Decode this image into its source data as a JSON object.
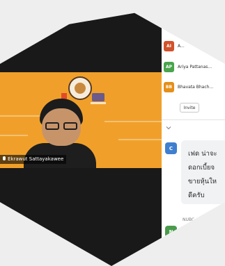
{
  "video": {
    "participant_name": "Ekrawut Sattayakawee"
  },
  "participants": [
    {
      "initials": "AI",
      "name": "A...",
      "color": "#d2522b"
    },
    {
      "initials": "AP",
      "name": "Ariya Pattanas...",
      "color": "#49a44c"
    },
    {
      "initials": "BB",
      "name": "Bhavata Bhach...",
      "color": "#e58f19"
    }
  ],
  "panel": {
    "invite_label": "Invite"
  },
  "chat": {
    "avatar_initial": "C",
    "lines": [
      "เฟด น่าจะ",
      "ดอกเบี้ยจ",
      "ขายหุ้นให",
      "ดีครับ"
    ],
    "sender_name": "NUBC",
    "next_avatar_initial": "N"
  }
}
